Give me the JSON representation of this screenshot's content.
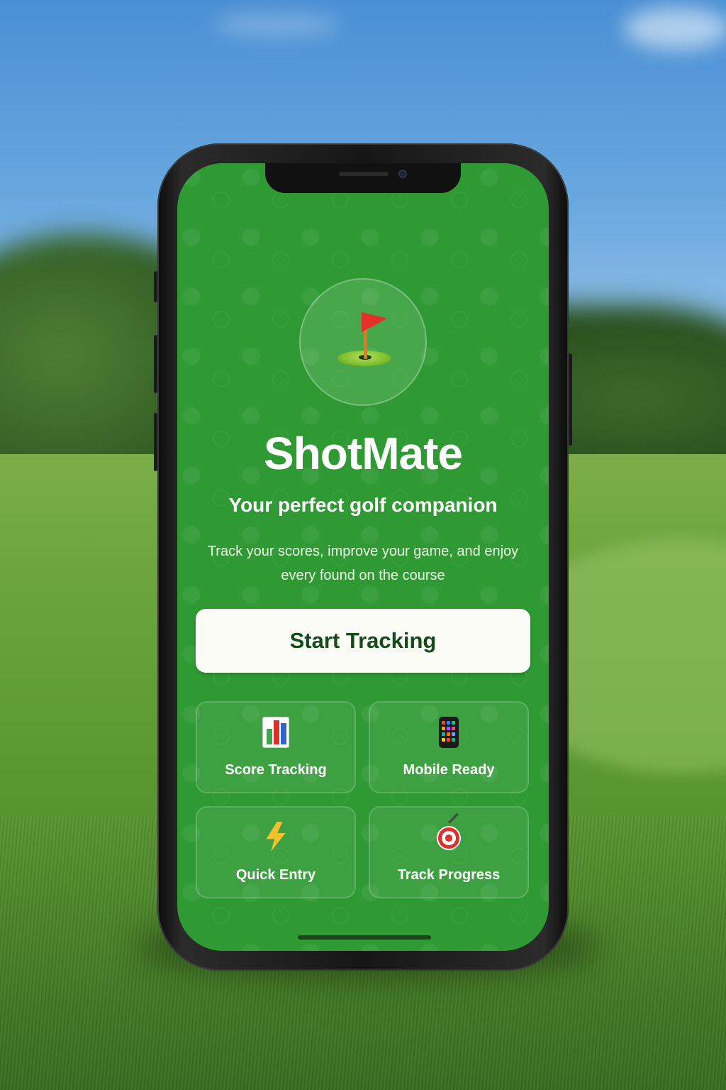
{
  "app": {
    "name": "ShotMate",
    "tagline": "Your perfect golf companion",
    "description": "Track your scores, improve your game, and enjoy every found on the course",
    "logo_icon": "golf-flag-icon"
  },
  "cta": {
    "label": "Start Tracking"
  },
  "features": [
    {
      "label": "Score Tracking",
      "icon": "bar-chart-icon"
    },
    {
      "label": "Mobile Ready",
      "icon": "tablet-icon"
    },
    {
      "label": "Quick Entry",
      "icon": "lightning-icon"
    },
    {
      "label": "Track Progress",
      "icon": "target-icon"
    }
  ],
  "colors": {
    "screen_background": "#2f9a33",
    "cta_background": "#fbfcf6",
    "cta_text": "#134b1a",
    "text_primary": "#ffffff"
  }
}
